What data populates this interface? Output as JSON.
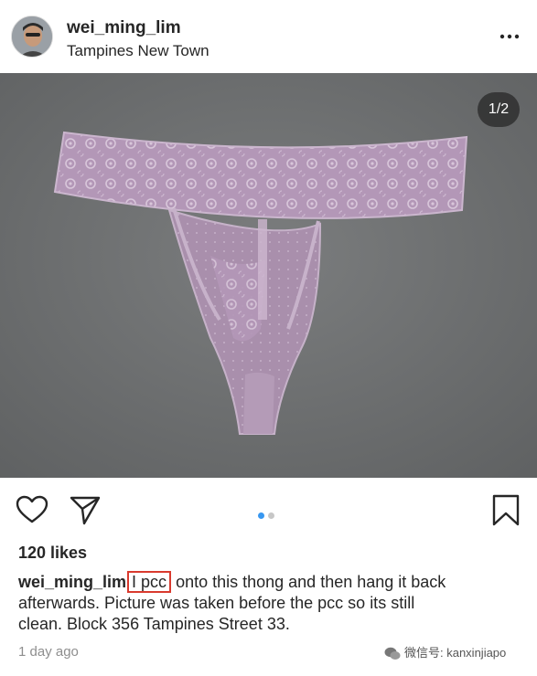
{
  "post": {
    "username": "wei_ming_lim",
    "location": "Tampines New Town",
    "image_counter": "1/2",
    "likes": "120 likes",
    "caption": {
      "username": "wei_ming_lim",
      "highlighted_text": "I pcc",
      "text_line1_rest": " onto this thong and then hang it back",
      "text_line2": "afterwards. Picture was taken before the pcc so its still",
      "text_line3": "clean. Block 356 Tampines Street 33."
    },
    "timestamp": "1 day ago",
    "carousel": {
      "total": 2,
      "current": 1
    }
  },
  "watermark": "微信号: kanxinjiapo",
  "icons": {
    "more": "more-horizontal-icon",
    "like": "heart-icon",
    "share": "send-icon",
    "save": "bookmark-icon"
  },
  "colors": {
    "highlight_box": "#d93a2e",
    "carousel_active": "#3897f0",
    "carousel_inactive": "#c7c7c7",
    "secondary_text": "#8e8e8e"
  }
}
